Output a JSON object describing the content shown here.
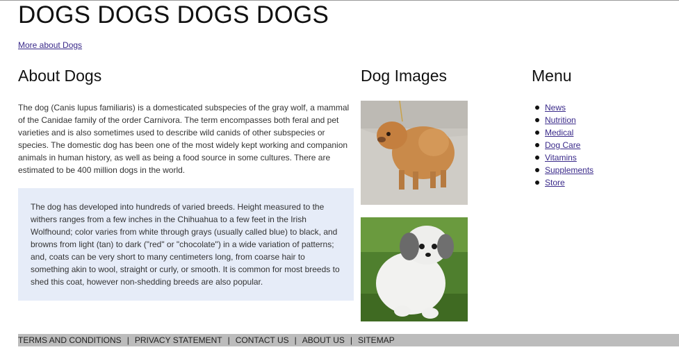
{
  "site_title": "DOGS DOGS DOGS DOGS",
  "more_link": "More about Dogs",
  "about": {
    "heading": "About Dogs",
    "intro": "The dog (Canis lupus familiaris) is a domesticated subspecies of the gray wolf, a mammal of the Canidae family of the order Carnivora. The term encompasses both feral and pet varieties and is also sometimes used to describe wild canids of other subspecies or species. The domestic dog has been one of the most widely kept working and companion animals in human history, as well as being a food source in some cultures. There are estimated to be 400 million dogs in the world.",
    "callout": "The dog has developed into hundreds of varied breeds. Height measured to the withers ranges from a few inches in the Chihuahua to a few feet in the Irish Wolfhound; color varies from white through grays (usually called blue) to black, and browns from light (tan) to dark (\"red\" or \"chocolate\") in a wide variation of patterns; and, coats can be very short to many centimeters long, from coarse hair to something akin to wool, straight or curly, or smooth. It is common for most breeds to shed this coat, however non-shedding breeds are also popular."
  },
  "images": {
    "heading": "Dog Images",
    "items": [
      "pomeranian-photo",
      "shih-tzu-puppy-photo"
    ]
  },
  "menu": {
    "heading": "Menu",
    "items": [
      "News",
      "Nutrition",
      "Medical",
      "Dog Care",
      "Vitamins",
      "Supplements",
      "Store"
    ]
  },
  "footer": {
    "links": [
      "TERMS AND CONDITIONS",
      "PRIVACY STATEMENT",
      "CONTACT US",
      "ABOUT US",
      "SITEMAP"
    ],
    "separator": "|"
  },
  "colors": {
    "link": "#3a2a8a",
    "callout_bg": "#e6ecf8",
    "footer_bg": "#bcbcbc"
  }
}
